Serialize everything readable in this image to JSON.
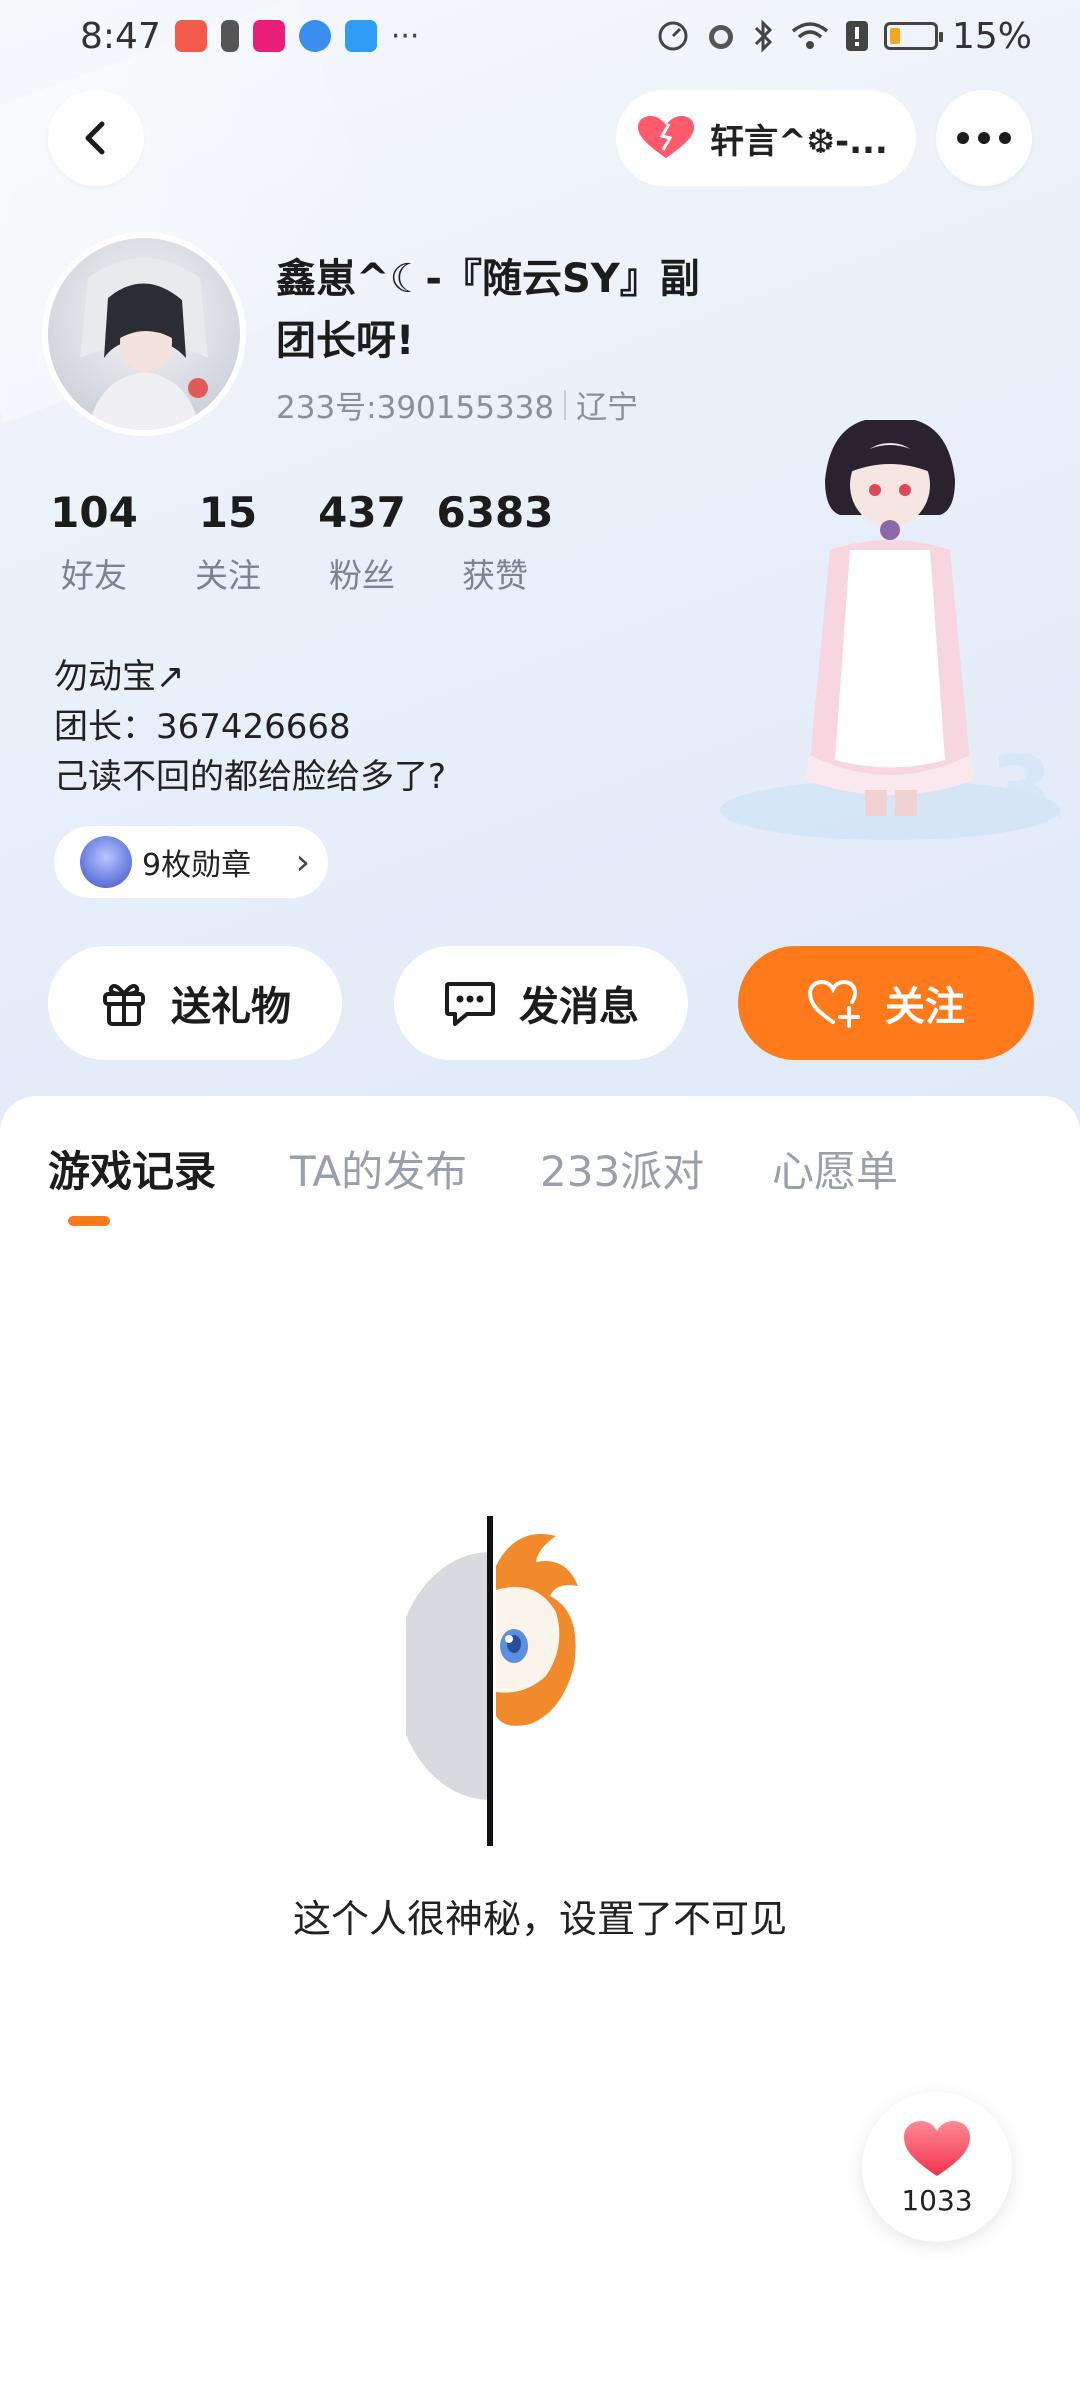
{
  "status_bar": {
    "time": "8:47",
    "more_indicator": "···",
    "battery_percent": "15%",
    "battery_level": 0.15,
    "icons": [
      "speed-icon",
      "alarm-icon",
      "bluetooth-icon",
      "wifi-icon",
      "alert-icon",
      "battery-icon"
    ]
  },
  "header": {
    "back_icon": "chevron-left-icon",
    "visitor_name": "轩言^❆-...",
    "more_icon": "more-dots-icon"
  },
  "profile": {
    "name": "鑫崽^☾-『随云SY』副团长呀!",
    "uid": "233号:390155338",
    "location": "辽宁",
    "stats": [
      {
        "value": "104",
        "label": "好友"
      },
      {
        "value": "15",
        "label": "关注"
      },
      {
        "value": "437",
        "label": "粉丝"
      },
      {
        "value": "6383",
        "label": "获赞"
      }
    ],
    "bio_lines": [
      "勿动宝↗",
      "团长：367426668",
      "己读不回的都给脸给多了?"
    ],
    "badge_text": "9枚勋章",
    "badge_chevron": "›"
  },
  "actions": {
    "gift": "送礼物",
    "message": "发消息",
    "follow": "关注"
  },
  "tabs": [
    {
      "label": "游戏记录",
      "active": true
    },
    {
      "label": "TA的发布",
      "active": false
    },
    {
      "label": "233派对",
      "active": false
    },
    {
      "label": "心愿单",
      "active": false
    }
  ],
  "empty_state": {
    "text": "这个人很神秘，设置了不可见"
  },
  "like_button": {
    "count": "1033"
  },
  "colors": {
    "accent": "#ff7a1a",
    "heart": "#ff5a6e",
    "muted": "#9aa0ab"
  }
}
